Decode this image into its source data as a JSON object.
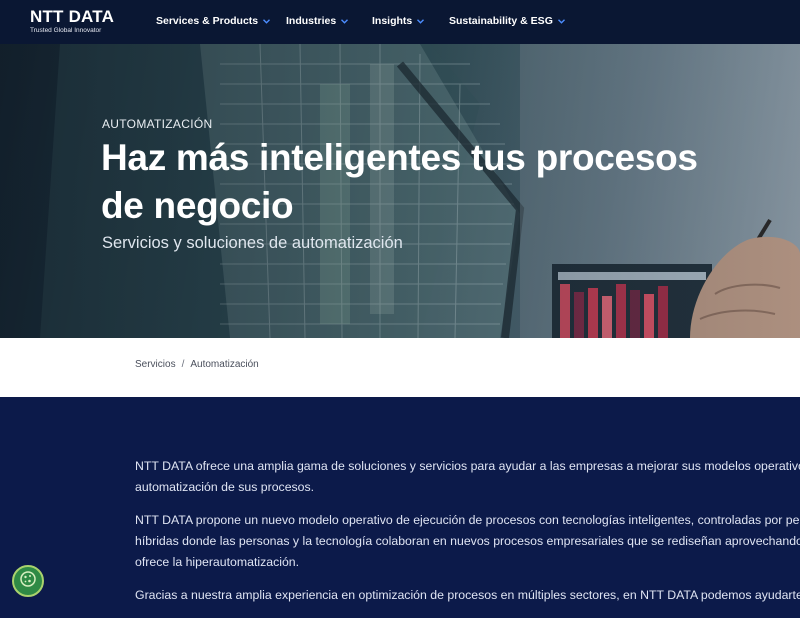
{
  "header": {
    "logo_text": "NTT DATA",
    "logo_tagline": "Trusted Global Innovator",
    "nav": [
      {
        "label": "Services & Products"
      },
      {
        "label": "Industries"
      },
      {
        "label": "Insights"
      },
      {
        "label": "Sustainability & ESG"
      }
    ]
  },
  "hero": {
    "eyebrow": "AUTOMATIZACIÓN",
    "title": "Haz más inteligentes tus procesos de negocio",
    "subtitle": "Servicios y soluciones de automatización"
  },
  "breadcrumb": {
    "items": [
      "Servicios",
      "Automatización"
    ],
    "separator": "/"
  },
  "content": {
    "paragraphs": [
      {
        "line1": "NTT DATA ofrece una amplia gama de soluciones y servicios para ayudar a las empresas a mejorar sus modelos operativos m",
        "line2": "automatización de sus procesos."
      },
      {
        "line1": "NTT DATA propone un nuevo modelo operativo de ejecución de procesos con tecnologías inteligentes, controladas por pers",
        "line2": "híbridas donde las personas y la tecnología colaboran en nuevos procesos empresariales que se rediseñan aprovechando la",
        "line3": "ofrece la hiperautomatización."
      },
      {
        "line1": "Gracias a nuestra amplia experiencia en optimización de procesos en múltiples sectores, en NTT DATA podemos ayudarte a"
      }
    ]
  },
  "colors": {
    "nav_bg": "#0a1733",
    "page_bg": "#0c1a4a",
    "cookie_button": "#2f8a45"
  },
  "icons": {
    "nav_chevron": "chevron-down-icon",
    "cookie": "cookie-icon"
  }
}
